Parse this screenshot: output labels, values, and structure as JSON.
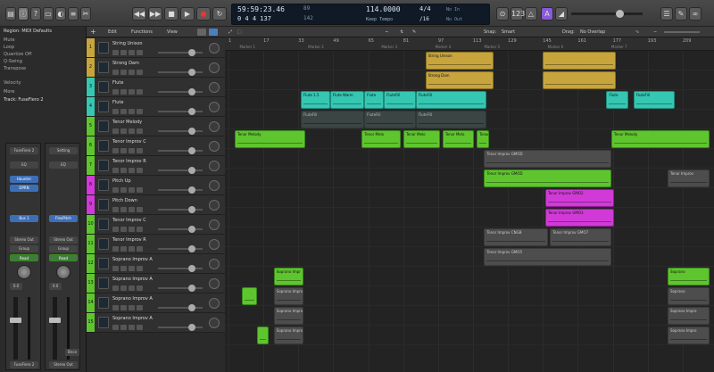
{
  "lcd": {
    "time": "59:59:23.46",
    "bars": "0  4  4  137",
    "bar_a": "89",
    "bar_b": "142",
    "tempo": "114.0000",
    "tempo_label": "Keep Tempo",
    "sig": "4/4",
    "sig_div": "/16",
    "key": "No In",
    "key2": "No Out"
  },
  "inspector": {
    "region_title": "Region: MIDI Defaults",
    "rows": [
      "Mute",
      "Loop",
      "Quantize  Off",
      "Q-Swing",
      "Transpose",
      "Velocity"
    ],
    "more": "More",
    "track_title": "Track: FuseFiero 2"
  },
  "strips": [
    {
      "name": "FuseFiero 2",
      "setting": "Setting",
      "eq": "EQ",
      "plugin1": "Haunter",
      "plugin2": "DPRN",
      "sends": "Bus 1",
      "out": "Stereo Out",
      "group": "Group",
      "auto": "Read",
      "value": "0.0",
      "label": "FuseFiero 2"
    },
    {
      "name": "Setting",
      "setting": "Setting",
      "eq": "EQ",
      "plugin1": "FlexPitch",
      "plugin2": "",
      "sends": "",
      "out": "Stereo Out",
      "group": "Group",
      "auto": "Read",
      "value": "0.0",
      "label": "Stereo Out",
      "bnc": "Bnce"
    }
  ],
  "tracklist_toolbar": {
    "edit": "Edit",
    "functions": "Functions",
    "view": "View"
  },
  "arrange_toolbar": {
    "snap_label": "Snap:",
    "snap": "Smart",
    "drag_label": "Drag:",
    "drag": "No Overlap"
  },
  "ruler": {
    "markers": [
      "Marker 1",
      "Marker 2",
      "Marker 3",
      "Marker 4",
      "Marker 5",
      "Marker 6",
      "Marker 7"
    ],
    "bars": [
      "1",
      "17",
      "33",
      "49",
      "65",
      "81",
      "97",
      "113",
      "129",
      "145",
      "161",
      "177",
      "193",
      "209"
    ]
  },
  "tracks": [
    {
      "num": "1",
      "name": "String Unison",
      "color": "#c7a53c"
    },
    {
      "num": "2",
      "name": "Strong Dam",
      "color": "#c7a53c"
    },
    {
      "num": "3",
      "name": "Flute",
      "color": "#35c7b1"
    },
    {
      "num": "4",
      "name": "Flute",
      "color": "#35c7b1"
    },
    {
      "num": "5",
      "name": "Tenor Melody",
      "color": "#5fc52f"
    },
    {
      "num": "6",
      "name": "Tenor Improv C",
      "color": "#5fc52f"
    },
    {
      "num": "7",
      "name": "Tenor Improv R",
      "color": "#5fc52f"
    },
    {
      "num": "8",
      "name": "Pitch Up",
      "color": "#d23ad8"
    },
    {
      "num": "9",
      "name": "Pitch Down",
      "color": "#d23ad8"
    },
    {
      "num": "10",
      "name": "Tenor Improv C",
      "color": "#5fc52f"
    },
    {
      "num": "11",
      "name": "Tenor Improv R",
      "color": "#5fc52f"
    },
    {
      "num": "12",
      "name": "Soprano Improv A",
      "color": "#5fc52f"
    },
    {
      "num": "13",
      "name": "Soprano Improv A",
      "color": "#5fc52f"
    },
    {
      "num": "14",
      "name": "Soprano Improv A",
      "color": "#5fc52f"
    },
    {
      "num": "15",
      "name": "Soprano Improv A",
      "color": "#5fc52f"
    }
  ],
  "regions": [
    {
      "lane": 0,
      "start": 0.41,
      "end": 0.55,
      "color": "gold",
      "label": "String Unison"
    },
    {
      "lane": 0,
      "start": 0.65,
      "end": 0.8,
      "color": "gold",
      "label": ""
    },
    {
      "lane": 1,
      "start": 0.41,
      "end": 0.55,
      "color": "gold",
      "label": "Strong Dam"
    },
    {
      "lane": 1,
      "start": 0.65,
      "end": 0.8,
      "color": "gold",
      "label": ""
    },
    {
      "lane": 2,
      "start": 0.155,
      "end": 0.215,
      "color": "teal",
      "label": "Flute 1.5"
    },
    {
      "lane": 2,
      "start": 0.215,
      "end": 0.285,
      "color": "teal",
      "label": "Flute Warm"
    },
    {
      "lane": 2,
      "start": 0.285,
      "end": 0.325,
      "color": "teal",
      "label": "Flute"
    },
    {
      "lane": 2,
      "start": 0.325,
      "end": 0.39,
      "color": "teal",
      "label": "FluteFill"
    },
    {
      "lane": 2,
      "start": 0.39,
      "end": 0.535,
      "color": "teal",
      "label": "FluteFill"
    },
    {
      "lane": 2,
      "start": 0.78,
      "end": 0.825,
      "color": "teal",
      "label": "Flute"
    },
    {
      "lane": 2,
      "start": 0.835,
      "end": 0.92,
      "color": "teal",
      "label": "FluteFill"
    },
    {
      "lane": 3,
      "start": 0.155,
      "end": 0.285,
      "color": "darkteal",
      "label": "FluteFill"
    },
    {
      "lane": 3,
      "start": 0.285,
      "end": 0.39,
      "color": "darkteal",
      "label": "FluteFill"
    },
    {
      "lane": 3,
      "start": 0.39,
      "end": 0.535,
      "color": "darkteal",
      "label": "FluteFill"
    },
    {
      "lane": 4,
      "start": 0.02,
      "end": 0.165,
      "color": "green",
      "label": "Tenor Melody"
    },
    {
      "lane": 4,
      "start": 0.28,
      "end": 0.36,
      "color": "green",
      "label": "Tenor Melo"
    },
    {
      "lane": 4,
      "start": 0.365,
      "end": 0.44,
      "color": "green",
      "label": "Tenor Melo"
    },
    {
      "lane": 4,
      "start": 0.445,
      "end": 0.51,
      "color": "green",
      "label": "Tenor Melo"
    },
    {
      "lane": 4,
      "start": 0.515,
      "end": 0.54,
      "color": "green",
      "label": "Tenor"
    },
    {
      "lane": 4,
      "start": 0.79,
      "end": 0.99,
      "color": "green",
      "label": "Tenor Melody"
    },
    {
      "lane": 5,
      "start": 0.53,
      "end": 0.79,
      "color": "grey",
      "label": "Tenor Improv GMOD"
    },
    {
      "lane": 6,
      "start": 0.53,
      "end": 0.79,
      "color": "green",
      "label": "Tenor Improv GMOD"
    },
    {
      "lane": 6,
      "start": 0.905,
      "end": 0.99,
      "color": "grey",
      "label": "Tenor Improv"
    },
    {
      "lane": 7,
      "start": 0.655,
      "end": 0.795,
      "color": "magenta",
      "label": "Tenor Improv GMO2"
    },
    {
      "lane": 8,
      "start": 0.655,
      "end": 0.795,
      "color": "magenta",
      "label": "Tenor Improv GMO3"
    },
    {
      "lane": 9,
      "start": 0.53,
      "end": 0.66,
      "color": "grey",
      "label": "Tenor Improv CNGB"
    },
    {
      "lane": 9,
      "start": 0.665,
      "end": 0.79,
      "color": "grey",
      "label": "Tenor Improv GMO7"
    },
    {
      "lane": 10,
      "start": 0.53,
      "end": 0.79,
      "color": "grey",
      "label": "Tenor Improv GMO5"
    },
    {
      "lane": 11,
      "start": 0.1,
      "end": 0.16,
      "color": "green",
      "label": "Soprano Impr"
    },
    {
      "lane": 11,
      "start": 0.905,
      "end": 0.99,
      "color": "green",
      "label": "Soprano"
    },
    {
      "lane": 12,
      "start": 0.035,
      "end": 0.065,
      "color": "green",
      "label": ""
    },
    {
      "lane": 12,
      "start": 0.1,
      "end": 0.16,
      "color": "grey",
      "label": "Soprano Impro"
    },
    {
      "lane": 12,
      "start": 0.905,
      "end": 0.99,
      "color": "grey",
      "label": "Soprano"
    },
    {
      "lane": 13,
      "start": 0.1,
      "end": 0.16,
      "color": "grey",
      "label": "Soprano Impro"
    },
    {
      "lane": 13,
      "start": 0.905,
      "end": 0.99,
      "color": "grey",
      "label": "Soprano Impro"
    },
    {
      "lane": 14,
      "start": 0.065,
      "end": 0.09,
      "color": "green",
      "label": ""
    },
    {
      "lane": 14,
      "start": 0.1,
      "end": 0.16,
      "color": "grey",
      "label": "Soprano Impro"
    },
    {
      "lane": 14,
      "start": 0.905,
      "end": 0.99,
      "color": "grey",
      "label": "Soprano Impro"
    }
  ],
  "colors": {
    "gold": "#c7a53c",
    "teal": "#35c7b1",
    "green": "#5fc52f",
    "magenta": "#d23ad8",
    "lcd_bg": "#0f1a26",
    "accent_purple": "#8a5ad8"
  }
}
